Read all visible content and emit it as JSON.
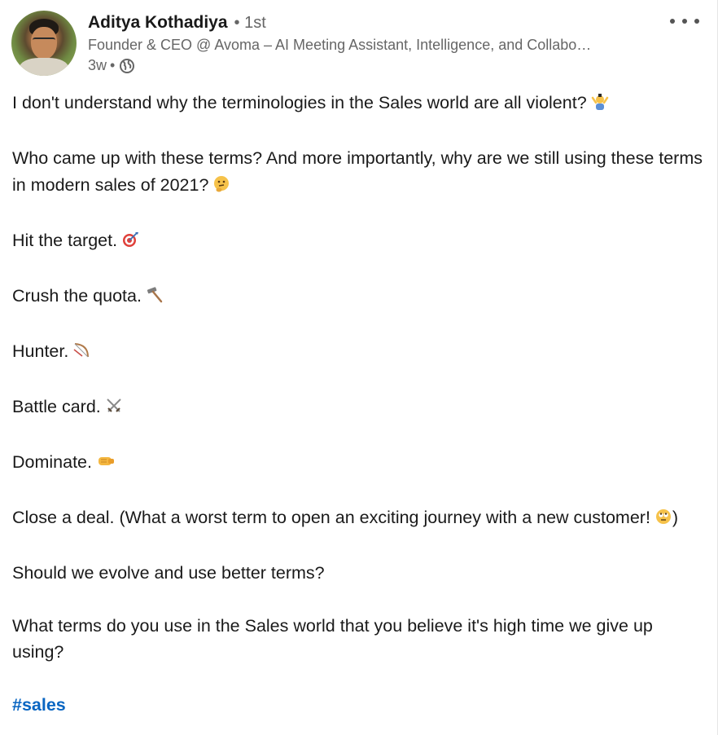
{
  "author": {
    "name": "Aditya Kothadiya",
    "degree": "1st",
    "headline": "Founder & CEO @ Avoma – AI Meeting Assistant, Intelligence, and Collabo…",
    "time": "3w",
    "separator": "•"
  },
  "post": {
    "p1": "I don't understand why the terminologies in the Sales world are all violent?",
    "p2": "Who came up with these terms? And more importantly, why are we still using these terms in modern sales of 2021?",
    "p3": "Hit the target.",
    "p4": "Crush the quota.",
    "p5": "Hunter.",
    "p6": "Battle card.",
    "p7": "Dominate.",
    "p8": "Close a deal. (What a worst term to open an exciting journey with a new customer!",
    "p8_end": ")",
    "p9": "Should we evolve and use better terms?",
    "p10": "What terms do you use in the Sales world that you believe it's high time we give up using?",
    "hashtag": "#sales"
  },
  "icons": {
    "p1": "person-shrugging-icon",
    "p2": "thinking-face-icon",
    "p3": "direct-hit-icon",
    "p4": "hammer-icon",
    "p5": "bow-and-arrow-icon",
    "p6": "crossed-swords-icon",
    "p7": "left-facing-fist-icon",
    "p8": "face-with-rolling-eyes-icon",
    "visibility": "globe-icon",
    "menu": "more-options-icon"
  },
  "colors": {
    "hashtag": "#0a66c2",
    "secondary_text": "#666666"
  }
}
